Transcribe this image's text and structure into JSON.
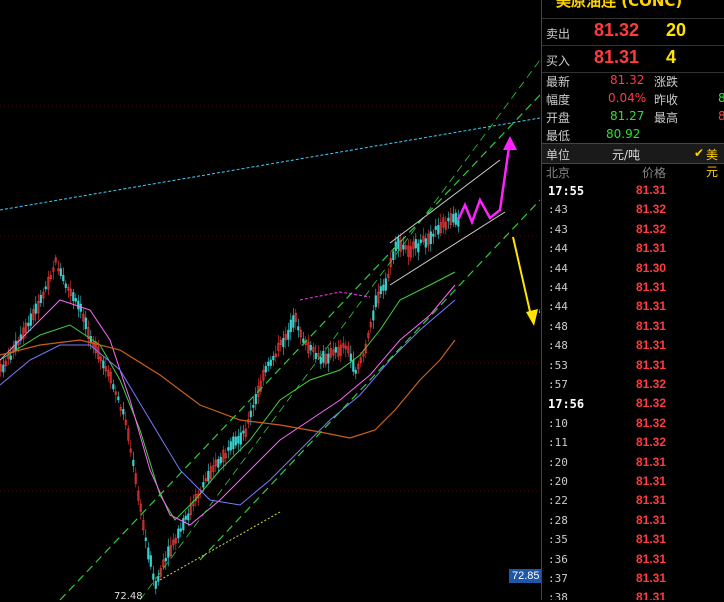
{
  "app": {
    "instrument_title": "美原油连 (CONC)",
    "top_links": [
      "",
      "",
      ""
    ]
  },
  "quote": {
    "sell_label": "卖出",
    "sell_price": "81.32",
    "sell_qty": "20",
    "buy_label": "买入",
    "buy_price": "81.31",
    "buy_qty": "4"
  },
  "stats": {
    "latest_label": "最新",
    "latest_value": "81.32",
    "change_label": "涨跌",
    "change_value": "",
    "amplitude_label": "幅度",
    "amplitude_value": "0.04%",
    "prev_close_label": "昨收",
    "prev_close_value": "8",
    "open_label": "开盘",
    "open_value": "81.27",
    "high_label": "最高",
    "high_value": "8",
    "low_label": "最低",
    "low_value": "80.92"
  },
  "unit": {
    "label": "单位",
    "value": "元/吨",
    "currency": "美元"
  },
  "ticks_header": {
    "location": "北京",
    "price": "价格"
  },
  "ticks": [
    {
      "time": "17:55",
      "price": "81.31",
      "strong": true
    },
    {
      "time": ":43",
      "price": "81.32"
    },
    {
      "time": ":43",
      "price": "81.32"
    },
    {
      "time": ":44",
      "price": "81.31"
    },
    {
      "time": ":44",
      "price": "81.30"
    },
    {
      "time": ":44",
      "price": "81.31"
    },
    {
      "time": ":44",
      "price": "81.31"
    },
    {
      "time": ":48",
      "price": "81.31"
    },
    {
      "time": ":48",
      "price": "81.31"
    },
    {
      "time": ":53",
      "price": "81.31"
    },
    {
      "time": ":57",
      "price": "81.32"
    },
    {
      "time": "17:56",
      "price": "81.32",
      "strong": true
    },
    {
      "time": ":10",
      "price": "81.32"
    },
    {
      "time": ":11",
      "price": "81.32"
    },
    {
      "time": ":20",
      "price": "81.31"
    },
    {
      "time": ":20",
      "price": "81.31"
    },
    {
      "time": ":22",
      "price": "81.31"
    },
    {
      "time": ":28",
      "price": "81.31"
    },
    {
      "time": ":35",
      "price": "81.31"
    },
    {
      "time": ":36",
      "price": "81.31"
    },
    {
      "time": ":37",
      "price": "81.31"
    },
    {
      "time": ":38",
      "price": "81.31"
    }
  ],
  "chart": {
    "price_axis_tag": "72.85",
    "low_marker": "72.48"
  },
  "colors": {
    "up": "#ff3b3b",
    "down": "#2ee02e",
    "accent_yellow": "#ffe400",
    "arrow_magenta": "#ff22ff"
  }
}
